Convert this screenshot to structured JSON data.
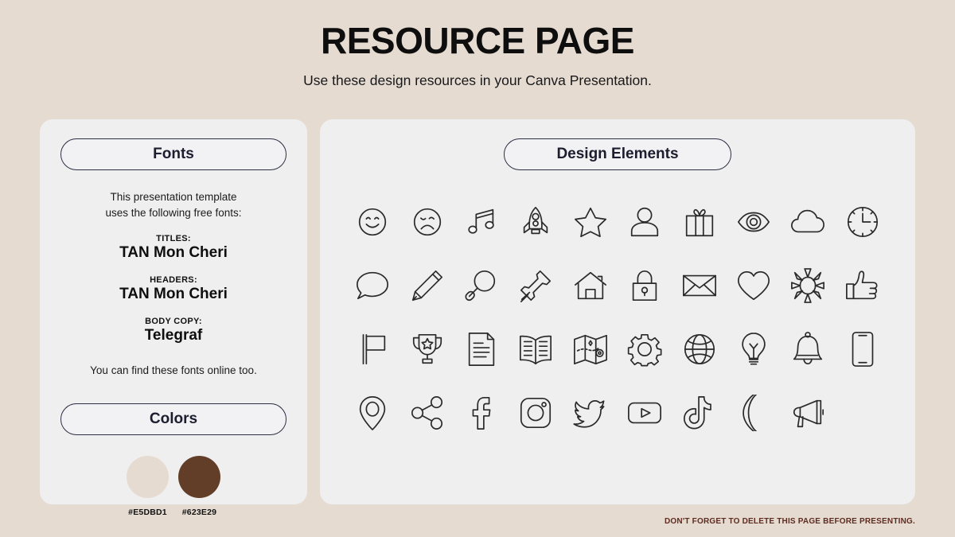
{
  "header": {
    "title": "RESOURCE PAGE",
    "subtitle": "Use these design resources in your Canva Presentation."
  },
  "fonts_panel": {
    "heading": "Fonts",
    "intro": "This presentation template\nuses the following free fonts:",
    "entries": [
      {
        "role": "TITLES:",
        "name": "TAN Mon Cheri"
      },
      {
        "role": "HEADERS:",
        "name": "TAN Mon Cheri"
      },
      {
        "role": "BODY COPY:",
        "name": "Telegraf"
      }
    ],
    "outro": "You can find these fonts online too."
  },
  "colors_panel": {
    "heading": "Colors",
    "swatches": [
      {
        "hex_label": "#E5DBD1",
        "hex": "#E5DBD1"
      },
      {
        "hex_label": "#623E29",
        "hex": "#623E29"
      }
    ]
  },
  "design_panel": {
    "heading": "Design Elements",
    "icons": [
      "smiley-face-icon",
      "sad-face-icon",
      "music-note-icon",
      "rocket-icon",
      "star-icon",
      "person-icon",
      "gift-icon",
      "eye-icon",
      "cloud-icon",
      "clock-icon",
      "speech-bubble-icon",
      "pencil-icon",
      "magnifying-glass-icon",
      "pushpin-icon",
      "house-icon",
      "lock-icon",
      "envelope-icon",
      "heart-icon",
      "sun-icon",
      "thumbs-up-icon",
      "flag-icon",
      "trophy-icon",
      "document-icon",
      "open-book-icon",
      "map-icon",
      "gear-icon",
      "globe-icon",
      "lightbulb-icon",
      "bell-icon",
      "smartphone-icon",
      "location-pin-icon",
      "share-icon",
      "facebook-icon",
      "instagram-icon",
      "twitter-icon",
      "youtube-icon",
      "tiktok-icon",
      "moon-icon",
      "megaphone-icon"
    ]
  },
  "footer": {
    "note": "DON'T FORGET TO DELETE THIS PAGE BEFORE PRESENTING."
  },
  "theme": {
    "background": "#E5DBD1",
    "panel": "#EFEFEF",
    "pill_border": "#2C2E43",
    "icon_stroke": "#2A2A2A",
    "footer_text": "#5E2B20"
  }
}
